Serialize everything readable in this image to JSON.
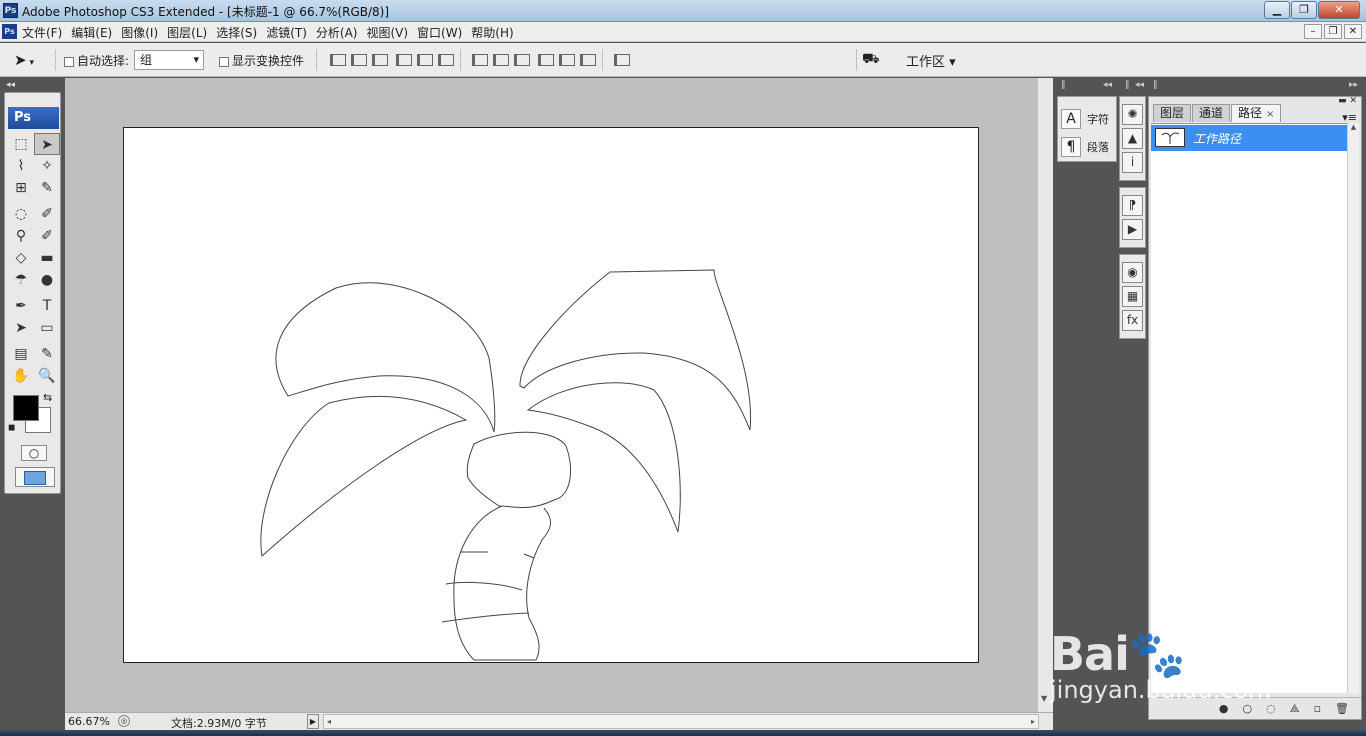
{
  "window": {
    "title": "Adobe Photoshop CS3 Extended - [未标题-1 @ 66.7%(RGB/8)]",
    "app_badge": "Ps",
    "buttons": [
      "▁",
      "❐",
      "✕"
    ]
  },
  "menubar": {
    "items": [
      "文件(F)",
      "编辑(E)",
      "图像(I)",
      "图层(L)",
      "选择(S)",
      "滤镜(T)",
      "分析(A)",
      "视图(V)",
      "窗口(W)",
      "帮助(H)"
    ],
    "mdi_buttons": [
      "–",
      "❐",
      "✕"
    ]
  },
  "options": {
    "auto_select_label": "自动选择:",
    "auto_select_value": "组",
    "show_transform_label": "显示变换控件",
    "workspace_label": "工作区 ▾"
  },
  "toolbox": {
    "badge": "Ps",
    "tools": [
      [
        "⬚",
        "➤"
      ],
      [
        "⌇",
        "✧"
      ],
      [
        "⊞",
        "✎"
      ],
      [
        "◌",
        "✐"
      ],
      [
        "⚲",
        "✐"
      ],
      [
        "◇",
        "▬"
      ],
      [
        "☂",
        "●"
      ],
      [
        "✒",
        "T"
      ],
      [
        "➤",
        "▭"
      ],
      [
        "▤",
        "✎"
      ],
      [
        "✋",
        "🔍"
      ]
    ],
    "swap": "⇆",
    "mini": "◼"
  },
  "status": {
    "zoom": "66.67%",
    "doc_info": "文档:2.93M/0 字节",
    "play": "▶",
    "scroll_left": "◂",
    "scroll_right": "▸"
  },
  "char_panel": {
    "items": [
      {
        "icon": "A",
        "label": "字符"
      },
      {
        "icon": "¶",
        "label": "段落"
      }
    ]
  },
  "side_icons": {
    "group1": [
      "✺",
      "▲",
      "i"
    ],
    "group2": [
      "⁋",
      "▶"
    ],
    "group3": [
      "◉",
      "▦",
      "fx"
    ]
  },
  "paths_panel": {
    "tabs": [
      "图层",
      "通道",
      "路径"
    ],
    "close": "×",
    "active_tab": "路径",
    "rows": [
      {
        "name": "工作路径"
      }
    ],
    "footer_icons": [
      "●",
      "○",
      "◌",
      "⟁",
      "▫",
      "🗑"
    ]
  },
  "watermark": {
    "brand": "Bai🐾经验",
    "sub": "jingyan.baidu.com"
  }
}
